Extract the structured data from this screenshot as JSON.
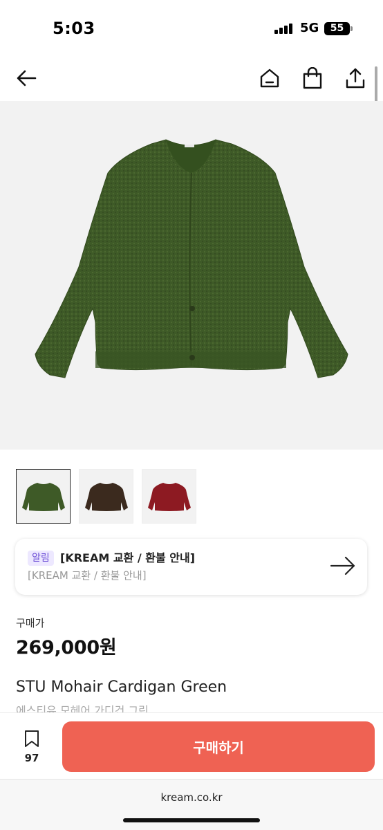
{
  "status_bar": {
    "time": "5:03",
    "network": "5G",
    "battery": "55"
  },
  "nav": {
    "back_icon": "arrow-left-icon",
    "home_icon": "home-icon",
    "bag_icon": "shopping-bag-icon",
    "share_icon": "share-icon"
  },
  "colors": {
    "product_green": "#3e5a27",
    "product_brown": "#3b2a1e",
    "product_red": "#8d1a22",
    "accent": "#ef6253",
    "badge_bg": "#ede8ff",
    "badge_text": "#6d4fd6"
  },
  "thumbnails": [
    {
      "label": "green",
      "selected": true
    },
    {
      "label": "brown",
      "selected": false
    },
    {
      "label": "red",
      "selected": false
    }
  ],
  "notice": {
    "badge": "알림",
    "title": "[KREAM 교환 / 환불 안내]",
    "subtitle": "[KREAM 교환 / 환불 안내]"
  },
  "product": {
    "price_label": "구매가",
    "price": "269,000원",
    "name": "STU Mohair Cardigan Green",
    "name_ko": "에스티유 모헤어 가디건 그린"
  },
  "actions": {
    "wish_count": "97",
    "buy_label": "구매하기"
  },
  "browser": {
    "url": "kream.co.kr"
  }
}
